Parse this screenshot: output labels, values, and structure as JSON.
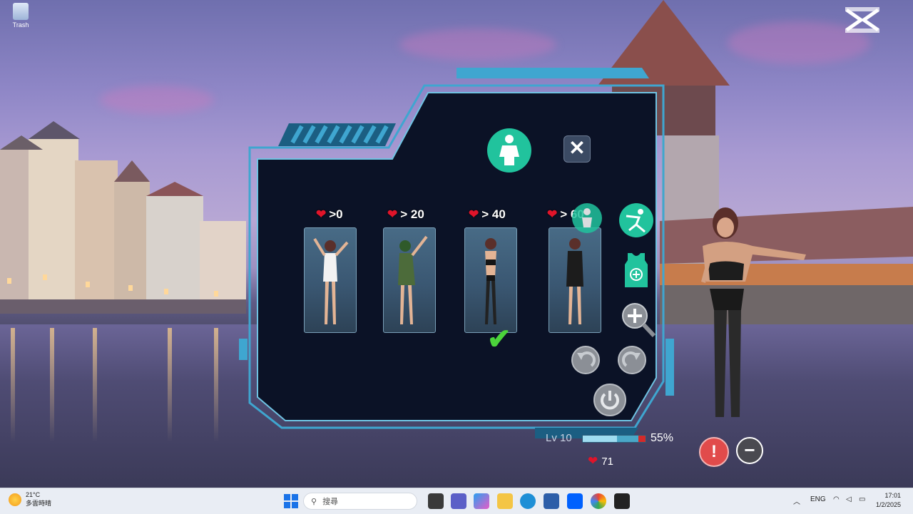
{
  "desktop": {
    "trash_label": "Trash"
  },
  "panel": {
    "outfits": [
      {
        "requirement": ">0",
        "selected": false
      },
      {
        "requirement": "> 20",
        "selected": false
      },
      {
        "requirement": "> 40",
        "selected": true
      },
      {
        "requirement": "> 60",
        "selected": false
      }
    ],
    "close_label": "✕",
    "check_mark": "✔"
  },
  "status": {
    "level": "Lv 10",
    "progress_percent": "55%",
    "progress_value": 0.55,
    "hearts": "71"
  },
  "buttons": {
    "warning": "!",
    "minus": "−"
  },
  "taskbar": {
    "weather_temp": "21°C",
    "weather_desc": "多雲時晴",
    "search_placeholder": "搜尋",
    "lang": "ENG",
    "time": "17:01",
    "date": "1/2/2025"
  },
  "colors": {
    "panel_bg": "#0b1226",
    "panel_frame": "#3fa6d0",
    "accent": "#21c39d"
  }
}
